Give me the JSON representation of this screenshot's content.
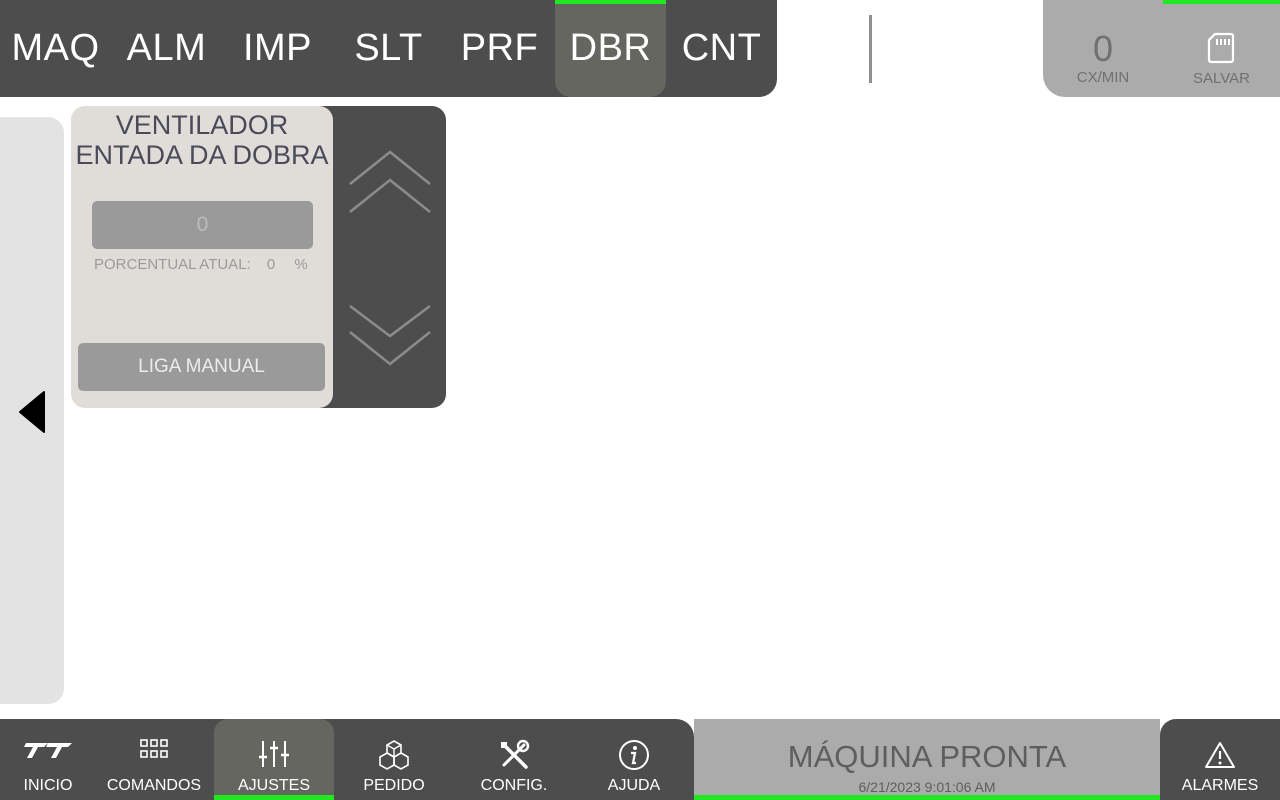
{
  "top_tabs": [
    {
      "label": "MAQ",
      "active": false
    },
    {
      "label": "ALM",
      "active": false
    },
    {
      "label": "IMP",
      "active": false
    },
    {
      "label": "SLT",
      "active": false
    },
    {
      "label": "PRF",
      "active": false
    },
    {
      "label": "DBR",
      "active": true
    },
    {
      "label": "CNT",
      "active": false
    }
  ],
  "nav": {
    "prev": "<",
    "next": ">"
  },
  "rate": {
    "value": "0",
    "label": "CX/MIN"
  },
  "save": {
    "label": "SALVAR",
    "icon": "sd-card-icon"
  },
  "side_panel": {
    "icon": "triangle-left-icon"
  },
  "card": {
    "title_line1": "VENTILADOR",
    "title_line2": "ENTADA DA DOBRA",
    "value": "0",
    "pct_label": "PORCENTUAL ATUAL:",
    "pct_value": "0",
    "pct_unit": "%",
    "manual_button": "LIGA MANUAL",
    "up_icon": "chevron-up-icon",
    "down_icon": "chevron-down-icon"
  },
  "bottom_tabs": [
    {
      "label": "INICIO",
      "icon": "logo-icon",
      "active": false
    },
    {
      "label": "COMANDOS",
      "icon": "grid-icon",
      "active": false
    },
    {
      "label": "AJUSTES",
      "icon": "sliders-icon",
      "active": true
    },
    {
      "label": "PEDIDO",
      "icon": "boxes-icon",
      "active": false
    },
    {
      "label": "CONFIG.",
      "icon": "tools-icon",
      "active": false
    },
    {
      "label": "AJUDA",
      "icon": "info-icon",
      "active": false
    }
  ],
  "status": {
    "title": "MÁQUINA PRONTA",
    "timestamp": "6/21/2023 9:01:06 AM"
  },
  "alarm": {
    "label": "ALARMES",
    "icon": "warning-icon"
  },
  "colors": {
    "accent_green": "#22e822",
    "bar_dark": "#4d4d4d",
    "bar_light": "#ababab",
    "card_bg": "#e0ddd8"
  }
}
